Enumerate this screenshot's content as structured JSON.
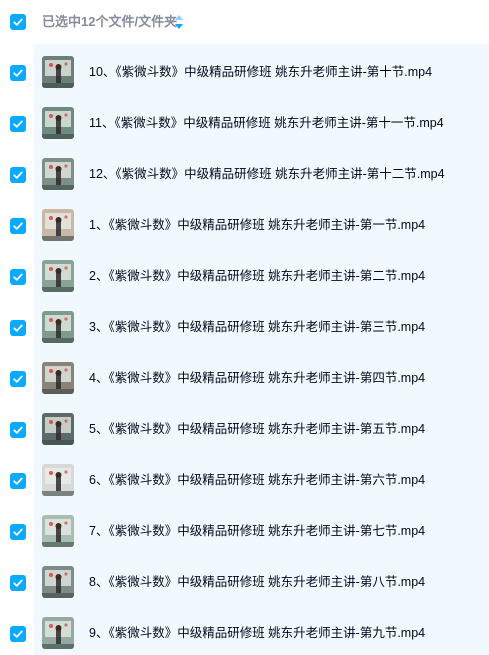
{
  "header": {
    "selection_text": "已选中12个文件/文件夹",
    "sort_icon": "sort-icon"
  },
  "colors": {
    "accent": "#09aaff",
    "list_bg": "#f1f8fe",
    "header_text": "#878c9c",
    "file_text": "#03081a"
  },
  "files": [
    {
      "name": "10、《紫微斗数》中级精品研修班 姚东升老师主讲-第十节.mp4",
      "selected": true
    },
    {
      "name": "11、《紫微斗数》中级精品研修班 姚东升老师主讲-第十一节.mp4",
      "selected": true
    },
    {
      "name": "12、《紫微斗数》中级精品研修班 姚东升老师主讲-第十二节.mp4",
      "selected": true
    },
    {
      "name": "1、《紫微斗数》中级精品研修班 姚东升老师主讲-第一节.mp4",
      "selected": true
    },
    {
      "name": "2、《紫微斗数》中级精品研修班 姚东升老师主讲-第二节.mp4",
      "selected": true
    },
    {
      "name": "3、《紫微斗数》中级精品研修班 姚东升老师主讲-第三节.mp4",
      "selected": true
    },
    {
      "name": "4、《紫微斗数》中级精品研修班 姚东升老师主讲-第四节.mp4",
      "selected": true
    },
    {
      "name": "5、《紫微斗数》中级精品研修班 姚东升老师主讲-第五节.mp4",
      "selected": true
    },
    {
      "name": "6、《紫微斗数》中级精品研修班 姚东升老师主讲-第六节.mp4",
      "selected": true
    },
    {
      "name": "7、《紫微斗数》中级精品研修班 姚东升老师主讲-第七节.mp4",
      "selected": true
    },
    {
      "name": "8、《紫微斗数》中级精品研修班 姚东升老师主讲-第八节.mp4",
      "selected": true
    },
    {
      "name": "9、《紫微斗数》中级精品研修班 姚东升老师主讲-第九节.mp4",
      "selected": true
    }
  ]
}
